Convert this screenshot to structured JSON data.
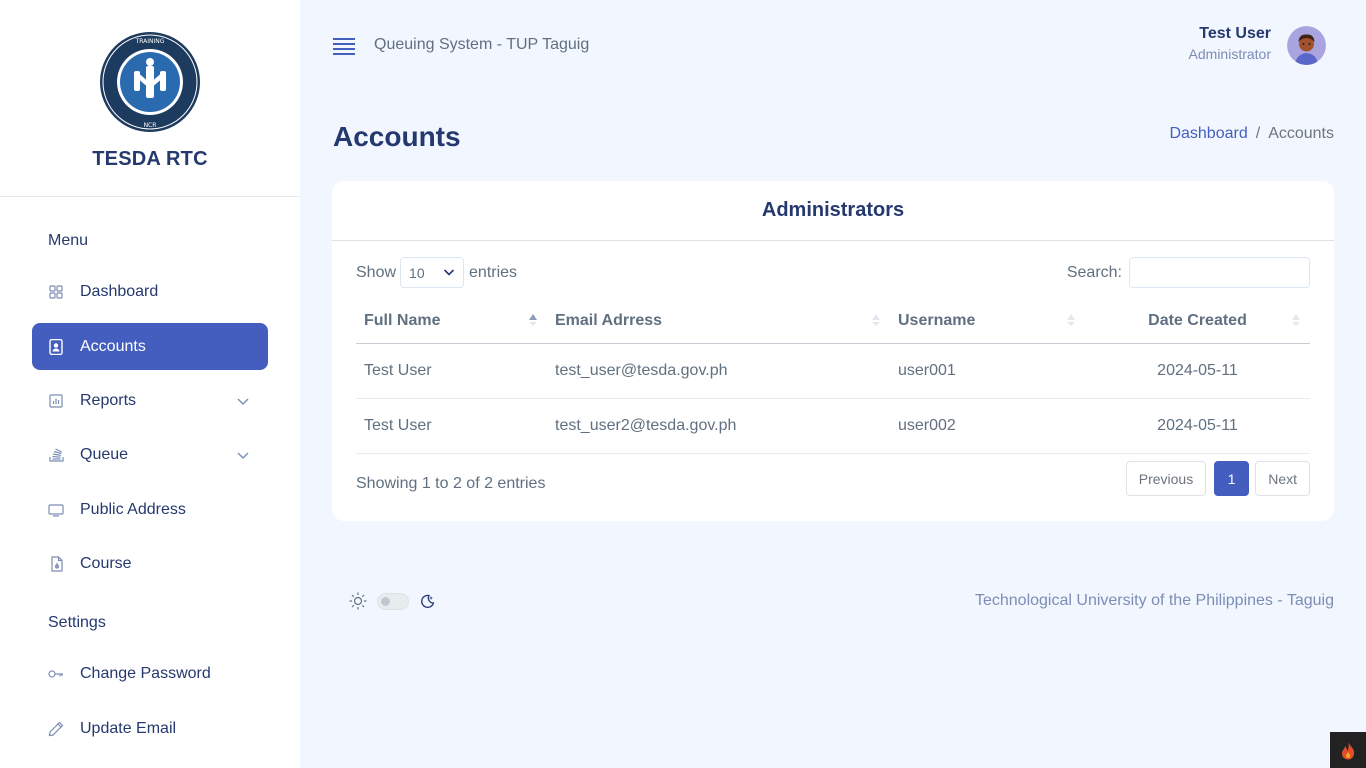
{
  "brand": {
    "name": "TESDA RTC",
    "logo_text": "REGIONAL TRAINING CENTER • NCR"
  },
  "sidebar": {
    "menu_title": "Menu",
    "settings_title": "Settings",
    "items": [
      {
        "label": "Dashboard",
        "icon": "grid-icon"
      },
      {
        "label": "Accounts",
        "icon": "id-badge-icon",
        "active": true
      },
      {
        "label": "Reports",
        "icon": "bar-chart-icon",
        "has_submenu": true
      },
      {
        "label": "Queue",
        "icon": "stack-icon",
        "has_submenu": true
      },
      {
        "label": "Public Address",
        "icon": "display-icon"
      },
      {
        "label": "Course",
        "icon": "file-icon"
      }
    ],
    "settings_items": [
      {
        "label": "Change Password",
        "icon": "key-icon"
      },
      {
        "label": "Update Email",
        "icon": "pencil-icon"
      }
    ]
  },
  "header": {
    "app_title": "Queuing System - TUP Taguig",
    "user_name": "Test User",
    "user_role": "Administrator"
  },
  "page": {
    "title": "Accounts",
    "breadcrumb": {
      "home": "Dashboard",
      "separator": "/",
      "current": "Accounts"
    }
  },
  "card": {
    "title": "Administrators",
    "show_label": "Show",
    "entries_label": "entries",
    "page_length": "10",
    "page_length_options": [
      "10"
    ],
    "search_label": "Search:",
    "search_value": "",
    "columns": [
      "Full Name",
      "Email Adrress",
      "Username",
      "Date Created"
    ],
    "rows": [
      {
        "name": "Test User",
        "email": "test_user@tesda.gov.ph",
        "username": "user001",
        "date": "2024-05-11"
      },
      {
        "name": "Test User",
        "email": "test_user2@tesda.gov.ph",
        "username": "user002",
        "date": "2024-05-11"
      }
    ],
    "info": "Showing 1 to 2 of 2 entries",
    "pager": {
      "previous": "Previous",
      "current": "1",
      "next": "Next"
    }
  },
  "footer": {
    "text": "Technological University of the Philippines - Taguig",
    "dark_mode": false
  },
  "colors": {
    "primary": "#435ebe",
    "heading": "#25396f",
    "body_bg": "#f2f7ff"
  }
}
